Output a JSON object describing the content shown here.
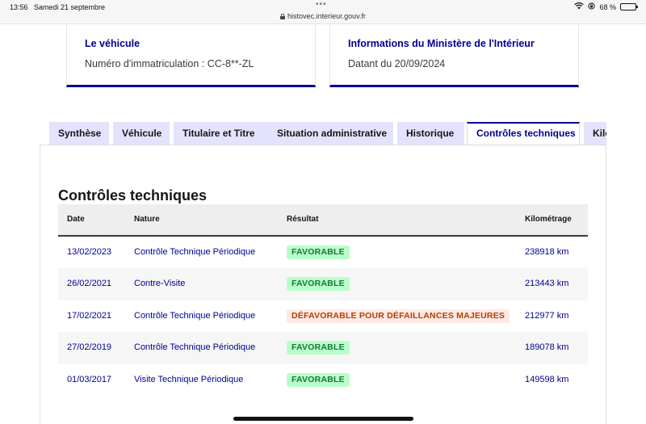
{
  "status_bar": {
    "time": "13:56",
    "date": "Samedi 21 septembre",
    "dots": "•••",
    "url": "histovec.interieur.gouv.fr",
    "battery": "68 %",
    "battery_level": 0.68
  },
  "cards": {
    "vehicle": {
      "title": "Le véhicule",
      "text": "Numéro d'immatriculation : CC-8**-ZL"
    },
    "ministry": {
      "title": "Informations du Ministère de l'Intérieur",
      "text": "Datant du 20/09/2024"
    }
  },
  "tabs": [
    {
      "label": "Synthèse",
      "active": false
    },
    {
      "label": "Véhicule",
      "active": false
    },
    {
      "label": "Titulaire et Titre",
      "active": false
    },
    {
      "label": "Situation administrative",
      "active": false
    },
    {
      "label": "Historique",
      "active": false
    },
    {
      "label": "Contrôles techniques",
      "active": true
    },
    {
      "label": "Kilo",
      "active": false
    }
  ],
  "section": {
    "title": "Contrôles techniques"
  },
  "table": {
    "headers": {
      "date": "Date",
      "nature": "Nature",
      "result": "Résultat",
      "km": "Kilométrage"
    },
    "rows": [
      {
        "date": "13/02/2023",
        "nature": "Contrôle Technique Périodique",
        "result": "FAVORABLE",
        "km": "238918 km"
      },
      {
        "date": "26/02/2021",
        "nature": "Contre-Visite",
        "result": "FAVORABLE",
        "km": "213443 km"
      },
      {
        "date": "17/02/2021",
        "nature": "Contrôle Technique Périodique",
        "result": "DÉFAVORABLE POUR DÉFAILLANCES MAJEURES",
        "km": "212977 km"
      },
      {
        "date": "27/02/2019",
        "nature": "Contrôle Technique Périodique",
        "result": "FAVORABLE",
        "km": "189078 km"
      },
      {
        "date": "01/03/2017",
        "nature": "Visite Technique Périodique",
        "result": "FAVORABLE",
        "km": "149598 km"
      }
    ]
  },
  "colors": {
    "accent": "#000091",
    "favorable_bg": "#b8fec9",
    "favorable_text": "#18753c",
    "defavorable_bg": "#ffe9e6",
    "defavorable_text": "#b34000",
    "tab_bg": "#e3e3fd"
  }
}
